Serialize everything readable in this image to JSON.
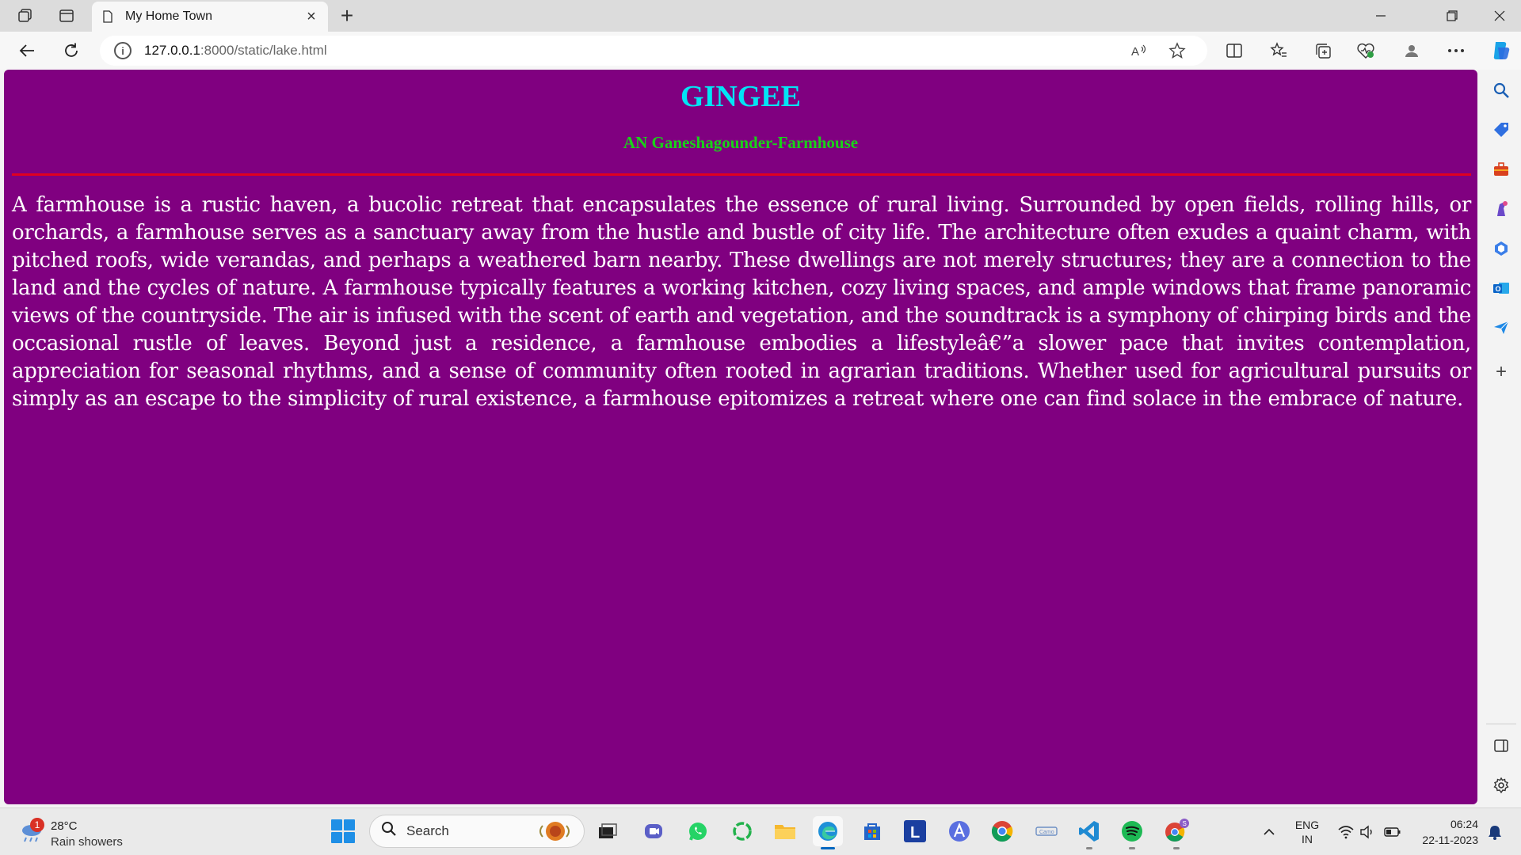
{
  "browser": {
    "tab_title": "My Home Town",
    "url_host": "127.0.0.1",
    "url_rest": ":8000/static/lake.html"
  },
  "page": {
    "heading": "GINGEE",
    "subheading": "AN Ganeshagounder-Farmhouse",
    "paragraph": "A farmhouse is a rustic haven, a bucolic retreat that encapsulates the essence of rural living. Surrounded by open fields, rolling hills, or orchards, a farmhouse serves as a sanctuary away from the hustle and bustle of city life. The architecture often exudes a quaint charm, with pitched roofs, wide verandas, and perhaps a weathered barn nearby. These dwellings are not merely structures; they are a connection to the land and the cycles of nature. A farmhouse typically features a working kitchen, cozy living spaces, and ample windows that frame panoramic views of the countryside. The air is infused with the scent of earth and vegetation, and the soundtrack is a symphony of chirping birds and the occasional rustle of leaves. Beyond just a residence, a farmhouse embodies a lifestyleâ€”a slower pace that invites contemplation, appreciation for seasonal rhythms, and a sense of community often rooted in agrarian traditions. Whether used for agricultural pursuits or simply as an escape to the simplicity of rural existence, a farmhouse epitomizes a retreat where one can find solace in the embrace of nature."
  },
  "taskbar": {
    "weather_temp": "28°C",
    "weather_desc": "Rain showers",
    "weather_badge": "1",
    "search_label": "Search",
    "lang_top": "ENG",
    "lang_bottom": "IN",
    "time": "06:24",
    "date": "22-11-2023"
  },
  "colors": {
    "page_background": "#800080",
    "heading": "#00e5f5",
    "subheading": "#19d219",
    "rule": "#e00020",
    "paragraph": "#ffffff"
  },
  "icons": {
    "sidebar": [
      "search-icon",
      "tag-icon",
      "toolbox-icon",
      "chess-icon",
      "m365-icon",
      "outlook-icon",
      "send-icon",
      "plus-icon",
      "split-panel-icon",
      "settings-icon"
    ]
  }
}
